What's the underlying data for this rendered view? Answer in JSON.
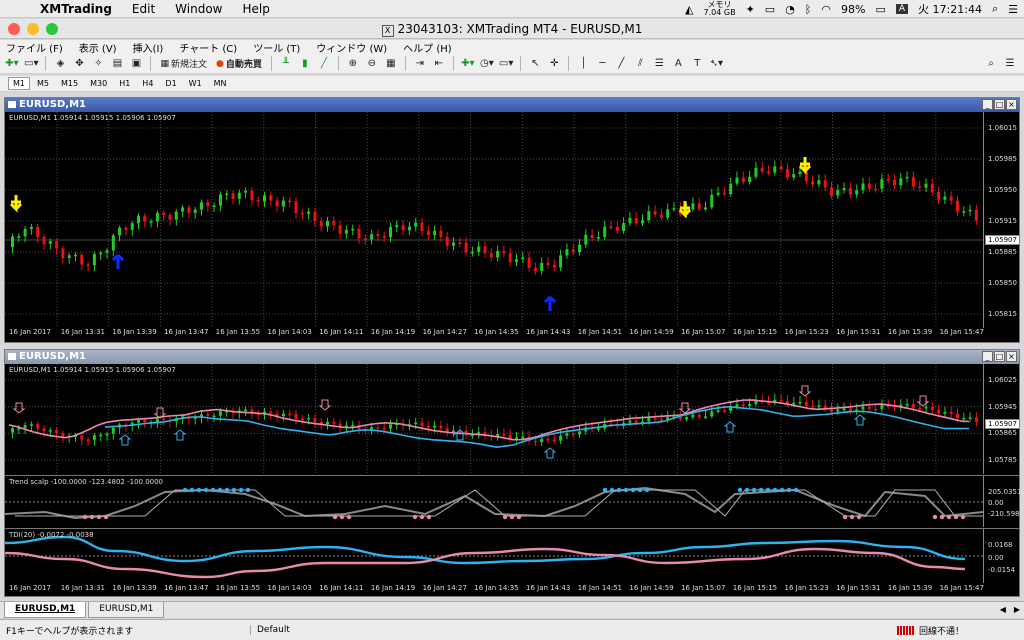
{
  "macmenu": {
    "app": "XMTrading",
    "items": [
      "Edit",
      "Window",
      "Help"
    ]
  },
  "macstatus": {
    "mem_label": "メモリ",
    "mem_value": "7.04 GB",
    "battery": "98%",
    "input": "A",
    "clock": "火 17:21:44"
  },
  "window": {
    "title": "23043103: XMTrading MT4 - EURUSD,M1"
  },
  "menu": [
    "ファイル (F)",
    "表示 (V)",
    "挿入(I)",
    "チャート (C)",
    "ツール (T)",
    "ウィンドウ (W)",
    "ヘルプ (H)"
  ],
  "toolbar": {
    "new_order": "新規注文",
    "auto_trade": "自動売買"
  },
  "timeframes": [
    "M1",
    "M5",
    "M15",
    "M30",
    "H1",
    "H4",
    "D1",
    "W1",
    "MN"
  ],
  "active_timeframe": "M1",
  "chart1": {
    "title": "EURUSD,M1",
    "info": "EURUSD,M1  1.05914 1.05915 1.05906 1.05907",
    "prices": [
      "1.06015",
      "1.05985",
      "1.05950",
      "1.05915",
      "1.05885",
      "1.05850",
      "1.05815"
    ],
    "current": "1.05907"
  },
  "chart2": {
    "title": "EURUSD,M1",
    "info": "EURUSD,M1  1.05914 1.05915 1.05906 1.05907",
    "prices": [
      "1.06025",
      "1.05945",
      "1.05865",
      "1.05785"
    ],
    "current": "1.05907",
    "trend_label": "Trend scalp -100.0000 -123.4802 -100.0000",
    "trend_levels": [
      "205.0351",
      "0.00",
      "-210.5986"
    ],
    "tdi_label": "TDI(20) -0.0072 -0.0038",
    "tdi_levels": [
      "0.0168",
      "0.00",
      "-0.0154"
    ]
  },
  "time_labels": [
    "16 Jan 2017",
    "16 Jan 13:31",
    "16 Jan 13:39",
    "16 Jan 13:47",
    "16 Jan 13:55",
    "16 Jan 14:03",
    "16 Jan 14:11",
    "16 Jan 14:19",
    "16 Jan 14:27",
    "16 Jan 14:35",
    "16 Jan 14:43",
    "16 Jan 14:51",
    "16 Jan 14:59",
    "16 Jan 15:07",
    "16 Jan 15:15",
    "16 Jan 15:23",
    "16 Jan 15:31",
    "16 Jan 15:39",
    "16 Jan 15:47"
  ],
  "tabs": [
    "EURUSD,M1",
    "EURUSD,M1"
  ],
  "statusbar": {
    "help": "F1キーでヘルプが表示されます",
    "profile": "Default",
    "connection": "回線不通！"
  },
  "colors": {
    "bull": "#22cc22",
    "bear": "#ee1111",
    "up_arrow": "#0a2cff",
    "down_arrow": "#ffee00",
    "ma_pink": "#e889b0",
    "ma_blue": "#2db3f0",
    "grid": "#4a4a4a"
  }
}
